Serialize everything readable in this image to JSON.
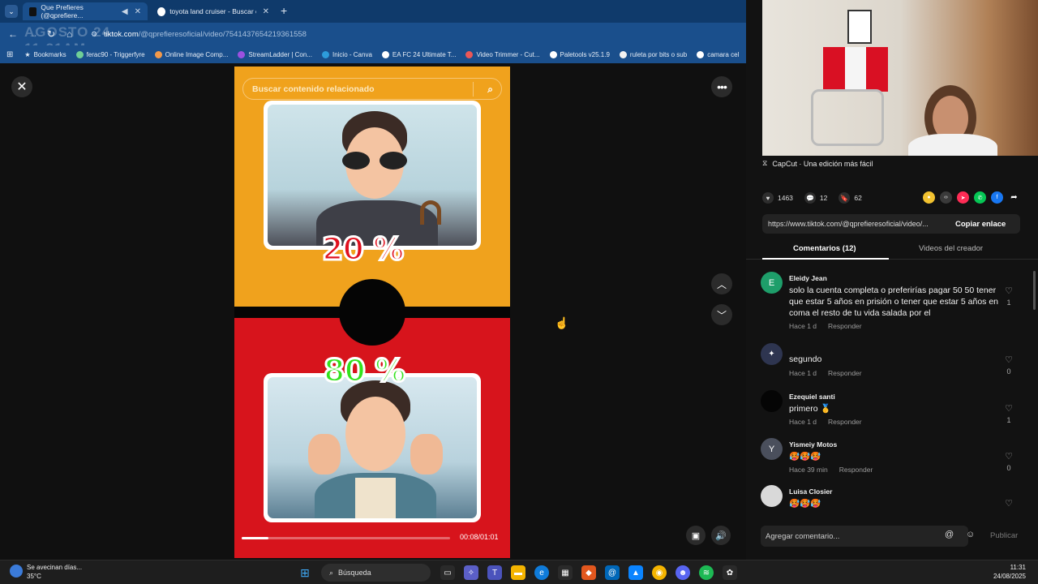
{
  "browser": {
    "tabs": [
      {
        "label": "Que Prefieres (@qprefiere...",
        "active": true,
        "favicon_color": "#111111"
      },
      {
        "label": "toyota land cruiser - Buscar con",
        "active": false,
        "favicon_color": "#ffffff"
      }
    ],
    "url_host": "tiktok.com",
    "url_path": "/@qprefieresoficial/video/7541437654219361558",
    "overlay_date": [
      "AGOSTO 24",
      "11:31AM"
    ],
    "bookmarks": [
      {
        "label": "Bookmarks",
        "color": "#f2c94c"
      },
      {
        "label": "ferac90 - Triggerfyre",
        "color": "#6fcf97"
      },
      {
        "label": "Online Image Comp...",
        "color": "#f2994a"
      },
      {
        "label": "StreamLadder | Con...",
        "color": "#9b51e0"
      },
      {
        "label": "Inicio - Canva",
        "color": "#2d9cdb"
      },
      {
        "label": "EA FC 24 Ultimate T...",
        "color": "#ffffff"
      },
      {
        "label": "Video Trimmer - Cut...",
        "color": "#eb5757"
      },
      {
        "label": "Paletools v25.1.9",
        "color": "#ffffff"
      },
      {
        "label": "ruleta por bits o sub",
        "color": "#f2f2f2"
      },
      {
        "label": "camara cel",
        "color": "#ffffff"
      }
    ]
  },
  "player": {
    "search_placeholder": "Buscar contenido relacionado",
    "option_top_percent": "20 %",
    "option_bottom_percent": "80 %",
    "time": "00:08/01:01",
    "progress": 0.13
  },
  "panel": {
    "capcut_text": "CapCut · Una edición más fácil",
    "likes": "1463",
    "comments_count": "12",
    "saves": "62",
    "share_colors": [
      "#f2c230",
      "#3a3a3a",
      "#fe2c55",
      "#06c755",
      "#1877f2"
    ],
    "link": "https://www.tiktok.com/@qprefieresoficial/video/...",
    "copy_label": "Copiar enlace",
    "tab_comments": "Comentarios (12)",
    "tab_creator": "Videos del creador",
    "comments": [
      {
        "initial": "E",
        "name": "Eleidy Jean",
        "text": "solo la cuenta completa o preferirías pagar 50 50 tener que estar 5 años en prisión o tener que estar 5 años en coma el resto de tu vida salada por el",
        "time": "Hace 1 d",
        "reply": "Responder",
        "likes": "1",
        "avatar_color": "#1e9e6a"
      },
      {
        "initial": "",
        "name": "",
        "text": "segundo",
        "time": "Hace 1 d",
        "reply": "Responder",
        "likes": "0",
        "avatar_color": "#2e3550"
      },
      {
        "initial": "",
        "name": "Ezequiel santi",
        "text": "primero 🥇",
        "time": "Hace 1 d",
        "reply": "Responder",
        "likes": "1",
        "avatar_color": "#050505"
      },
      {
        "initial": "Y",
        "name": "Yismeiy Motos",
        "text": "🥵🥵🥵",
        "time": "Hace 39 min",
        "reply": "Responder",
        "likes": "0",
        "avatar_color": "#4a4f5c"
      },
      {
        "initial": "",
        "name": "Luisa Closier",
        "text": "🥵🥵🥵",
        "time": "",
        "reply": "",
        "likes": "",
        "avatar_color": "#d9d9d9"
      }
    ],
    "composer_placeholder": "Agregar comentario...",
    "publish_label": "Publicar"
  },
  "taskbar": {
    "weather_title": "Se avecinan días...",
    "weather_temp": "35°C",
    "search_label": "Búsqueda",
    "time": "11:31",
    "date": "24/08/2025",
    "app_colors": [
      "#0078d4",
      "#f25022",
      "#5b5fc7",
      "#ffb900",
      "#0f7bd9",
      "#2a2a2a",
      "#e2571e",
      "#0067b8",
      "#0a84ff",
      "#f4b400",
      "#5865f2",
      "#1db954",
      "#d04437"
    ]
  }
}
